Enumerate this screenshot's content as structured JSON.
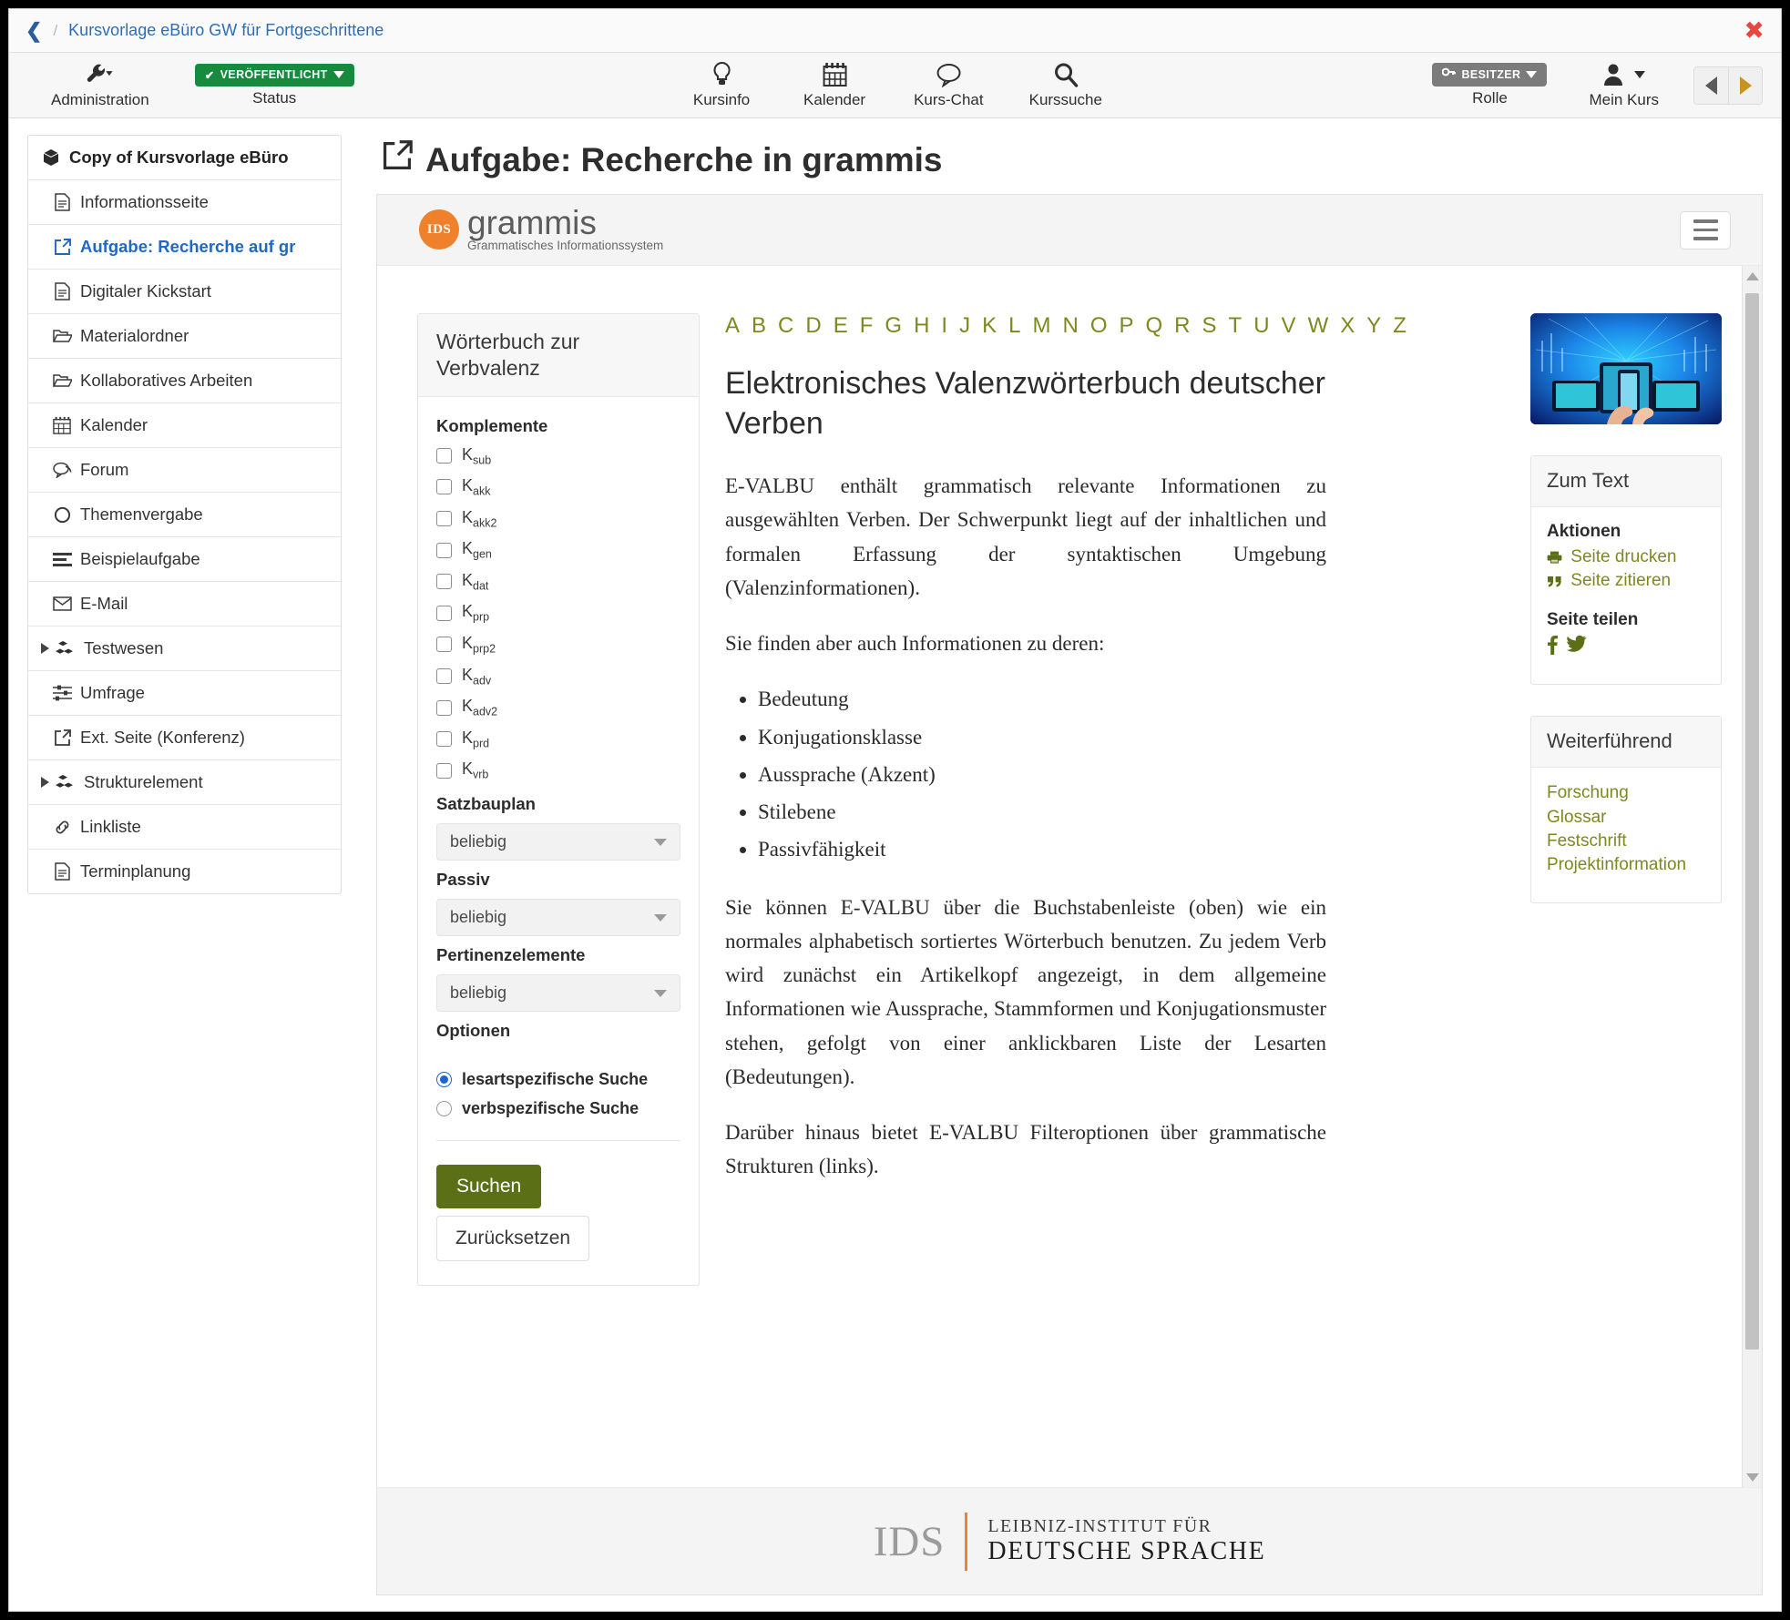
{
  "breadcrumb": {
    "back_icon": "chevron-left-icon",
    "separator": "/",
    "course": "Kursvorlage eBüro GW für Fortgeschrittene",
    "close_label": "✖"
  },
  "toolbar": {
    "administration": {
      "label": "Administration",
      "icon": "wrench-icon"
    },
    "status": {
      "label": "Status",
      "badge": "VERÖFFENTLICHT",
      "check": "✔",
      "color": "#168a3d"
    },
    "center_items": [
      {
        "label": "Kursinfo",
        "icon": "lightbulb-icon"
      },
      {
        "label": "Kalender",
        "icon": "calendar-icon"
      },
      {
        "label": "Kurs-Chat",
        "icon": "speech-bubble-icon"
      },
      {
        "label": "Kurssuche",
        "icon": "magnifier-icon"
      }
    ],
    "role": {
      "label": "Rolle",
      "badge": "BESITZER",
      "icon": "key-icon",
      "color": "#7b7b7b"
    },
    "my_course": {
      "label": "Mein Kurs",
      "icon": "person-icon"
    },
    "nav_prev": "◀",
    "nav_next": "▶"
  },
  "sidebar": {
    "header": {
      "label": "Copy of Kursvorlage eBüro",
      "icon": "package-icon"
    },
    "items": [
      {
        "label": "Informationsseite",
        "icon": "document-icon",
        "active": false,
        "twisty": false
      },
      {
        "label": "Aufgabe: Recherche auf gr",
        "icon": "external-link-icon",
        "active": true,
        "twisty": false
      },
      {
        "label": "Digitaler Kickstart",
        "icon": "document-icon",
        "active": false,
        "twisty": false
      },
      {
        "label": "Materialordner",
        "icon": "folder-open-icon",
        "active": false,
        "twisty": false
      },
      {
        "label": "Kollaboratives Arbeiten",
        "icon": "folder-open-icon",
        "active": false,
        "twisty": false
      },
      {
        "label": "Kalender",
        "icon": "calendar-icon",
        "active": false,
        "twisty": false
      },
      {
        "label": "Forum",
        "icon": "speech-bubbles-icon",
        "active": false,
        "twisty": false
      },
      {
        "label": "Themenvergabe",
        "icon": "circle-icon",
        "active": false,
        "twisty": false
      },
      {
        "label": "Beispielaufgabe",
        "icon": "list-lines-icon",
        "active": false,
        "twisty": false
      },
      {
        "label": "E-Mail",
        "icon": "envelope-icon",
        "active": false,
        "twisty": false
      },
      {
        "label": "Testwesen",
        "icon": "blocks-icon",
        "active": false,
        "twisty": true
      },
      {
        "label": "Umfrage",
        "icon": "sliders-icon",
        "active": false,
        "twisty": false
      },
      {
        "label": "Ext. Seite (Konferenz)",
        "icon": "external-link-icon",
        "active": false,
        "twisty": false
      },
      {
        "label": "Strukturelement",
        "icon": "blocks-icon",
        "active": false,
        "twisty": true
      },
      {
        "label": "Linkliste",
        "icon": "chain-link-icon",
        "active": false,
        "twisty": false
      },
      {
        "label": "Terminplanung",
        "icon": "document-icon",
        "active": false,
        "twisty": false
      }
    ]
  },
  "page": {
    "title": "Aufgabe: Recherche in grammis",
    "title_icon": "external-link-icon"
  },
  "embedded_site": {
    "logo": {
      "badge": "IDS",
      "word": "grammis",
      "subtitle": "Grammatisches Informationssystem",
      "badge_color": "#f0812c"
    },
    "menu_button": "hamburger-icon",
    "search_panel": {
      "title": "Wörterbuch zur Verbvalenz",
      "komplemente_label": "Komplemente",
      "checkboxes": [
        {
          "base": "K",
          "sub": "sub",
          "checked": false
        },
        {
          "base": "K",
          "sub": "akk",
          "checked": false
        },
        {
          "base": "K",
          "sub": "akk2",
          "checked": false
        },
        {
          "base": "K",
          "sub": "gen",
          "checked": false
        },
        {
          "base": "K",
          "sub": "dat",
          "checked": false
        },
        {
          "base": "K",
          "sub": "prp",
          "checked": false
        },
        {
          "base": "K",
          "sub": "prp2",
          "checked": false
        },
        {
          "base": "K",
          "sub": "adv",
          "checked": false
        },
        {
          "base": "K",
          "sub": "adv2",
          "checked": false
        },
        {
          "base": "K",
          "sub": "prd",
          "checked": false
        },
        {
          "base": "K",
          "sub": "vrb",
          "checked": false
        }
      ],
      "selects": [
        {
          "label": "Satzbauplan",
          "value": "beliebig"
        },
        {
          "label": "Passiv",
          "value": "beliebig"
        },
        {
          "label": "Pertinenzelemente",
          "value": "beliebig"
        }
      ],
      "optionen_label": "Optionen",
      "radios": [
        {
          "label": "lesartspezifische Suche",
          "selected": true
        },
        {
          "label": "verbspezifische Suche",
          "selected": false
        }
      ],
      "search_button": "Suchen",
      "reset_button": "Zurücksetzen"
    },
    "alphabet": [
      "A",
      "B",
      "C",
      "D",
      "E",
      "F",
      "G",
      "H",
      "I",
      "J",
      "K",
      "L",
      "M",
      "N",
      "O",
      "P",
      "Q",
      "R",
      "S",
      "T",
      "U",
      "V",
      "W",
      "X",
      "Y",
      "Z"
    ],
    "article": {
      "heading": "Elektronisches Valenzwörterbuch deutscher Verben",
      "p1": "E-VALBU enthält grammatisch relevante Informationen zu ausgewählten Verben. Der Schwerpunkt liegt auf der inhaltlichen und formalen Erfassung der syntaktischen Umgebung (Valenzinformationen).",
      "p2": "Sie finden aber auch Informationen zu deren:",
      "bullets": [
        "Bedeutung",
        "Konjugationsklasse",
        "Aussprache (Akzent)",
        "Stilebene",
        "Passivfähigkeit"
      ],
      "p3": "Sie können E-VALBU über die Buchstabenleiste (oben) wie ein normales alphabetisch sortiertes Wörterbuch benutzen. Zu jedem Verb wird zunächst ein Artikelkopf angezeigt, in dem allgemeine Informationen wie Aussprache, Stammformen und Konjugationsmuster stehen, gefolgt von einer anklickbaren Liste der Lesarten (Bedeutungen).",
      "p4": "Darüber hinaus bietet E-VALBU Filteroptionen über grammatische Strukturen (links)."
    },
    "rail": {
      "teaser_image": "devices-network-image",
      "zum_text": {
        "title": "Zum Text",
        "aktionen_label": "Aktionen",
        "links": [
          {
            "label": "Seite drucken",
            "icon": "printer-icon"
          },
          {
            "label": "Seite zitieren",
            "icon": "quote-icon"
          }
        ],
        "share_label": "Seite teilen",
        "share_icons": [
          {
            "name": "facebook-icon",
            "glyph": "f"
          },
          {
            "name": "twitter-icon",
            "glyph": "🐦"
          }
        ]
      },
      "weiterfuehrend": {
        "title": "Weiterführend",
        "links": [
          "Forschung",
          "Glossar",
          "Festschrift",
          "Projektinformation"
        ]
      }
    },
    "footer": {
      "ids": "IDS",
      "line1": "LEIBNIZ-INSTITUT FÜR",
      "line2": "DEUTSCHE SPRACHE",
      "accent": "#f0842e"
    }
  }
}
